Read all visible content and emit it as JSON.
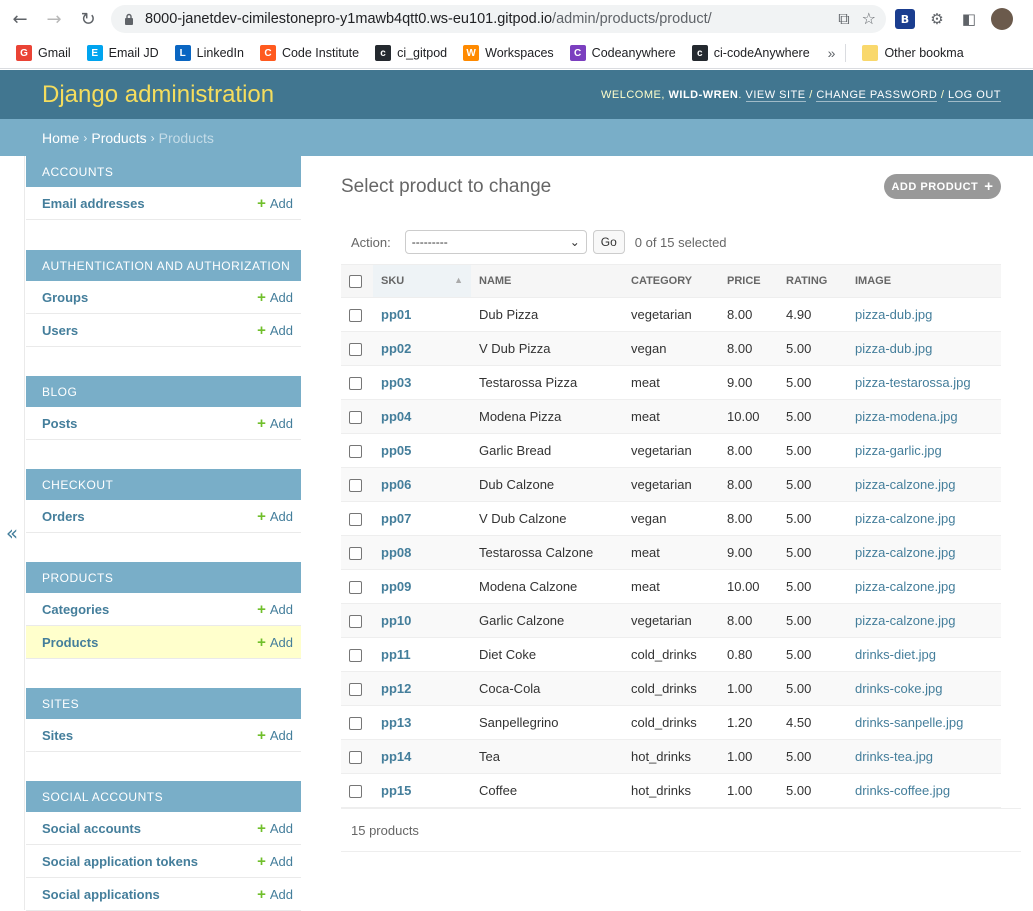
{
  "browser": {
    "url_host": "8000-janetdev-cimilestonepro-y1mawb4qtt0.ws-eu101.gitpod.io",
    "url_path": "/admin/products/product/",
    "bookmarks": [
      {
        "label": "Gmail",
        "icon": "gmail-icon",
        "color": "#ea4335"
      },
      {
        "label": "Email JD",
        "icon": "microsoft-icon",
        "color": "#00a4ef"
      },
      {
        "label": "LinkedIn",
        "icon": "linkedin-icon",
        "color": "#0a66c2"
      },
      {
        "label": "Code Institute",
        "icon": "code-institute-icon",
        "color": "#ff5a1f"
      },
      {
        "label": "ci_gitpod",
        "icon": "github-icon",
        "color": "#24292f"
      },
      {
        "label": "Workspaces",
        "icon": "gitpod-icon",
        "color": "#ff8a00"
      },
      {
        "label": "Codeanywhere",
        "icon": "codeanywhere-icon",
        "color": "#7b3fbf"
      },
      {
        "label": "ci-codeAnywhere",
        "icon": "github-icon",
        "color": "#24292f"
      }
    ],
    "bookmarks_more": "»",
    "other_bookmarks": "Other bookma"
  },
  "header": {
    "brand": "Django administration",
    "welcome": "WELCOME,",
    "user": "WILD-WREN",
    "view_site": "VIEW SITE",
    "change_password": "CHANGE PASSWORD",
    "log_out": "LOG OUT"
  },
  "breadcrumbs": {
    "home": "Home",
    "app": "Products",
    "current": "Products"
  },
  "sidebar": {
    "toggle": "«",
    "add_label": "Add",
    "modules": [
      {
        "caption": "ACCOUNTS",
        "rows": [
          "Email addresses"
        ]
      },
      {
        "caption": "AUTHENTICATION AND AUTHORIZATION",
        "rows": [
          "Groups",
          "Users"
        ]
      },
      {
        "caption": "BLOG",
        "rows": [
          "Posts"
        ]
      },
      {
        "caption": "CHECKOUT",
        "rows": [
          "Orders"
        ]
      },
      {
        "caption": "PRODUCTS",
        "rows": [
          "Categories",
          "Products"
        ]
      },
      {
        "caption": "SITES",
        "rows": [
          "Sites"
        ]
      },
      {
        "caption": "SOCIAL ACCOUNTS",
        "rows": [
          "Social accounts",
          "Social application tokens",
          "Social applications"
        ]
      }
    ],
    "current_row": "Products"
  },
  "main": {
    "title": "Select product to change",
    "add_button": "ADD PRODUCT",
    "action_label": "Action:",
    "action_selected": "---------",
    "go": "Go",
    "selected_count": "0 of 15 selected",
    "columns": [
      "SKU",
      "NAME",
      "CATEGORY",
      "PRICE",
      "RATING",
      "IMAGE"
    ],
    "rows": [
      [
        "pp01",
        "Dub Pizza",
        "vegetarian",
        "8.00",
        "4.90",
        "pizza-dub.jpg"
      ],
      [
        "pp02",
        "V Dub Pizza",
        "vegan",
        "8.00",
        "5.00",
        "pizza-dub.jpg"
      ],
      [
        "pp03",
        "Testarossa Pizza",
        "meat",
        "9.00",
        "5.00",
        "pizza-testarossa.jpg"
      ],
      [
        "pp04",
        "Modena Pizza",
        "meat",
        "10.00",
        "5.00",
        "pizza-modena.jpg"
      ],
      [
        "pp05",
        "Garlic Bread",
        "vegetarian",
        "8.00",
        "5.00",
        "pizza-garlic.jpg"
      ],
      [
        "pp06",
        "Dub Calzone",
        "vegetarian",
        "8.00",
        "5.00",
        "pizza-calzone.jpg"
      ],
      [
        "pp07",
        "V Dub Calzone",
        "vegan",
        "8.00",
        "5.00",
        "pizza-calzone.jpg"
      ],
      [
        "pp08",
        "Testarossa Calzone",
        "meat",
        "9.00",
        "5.00",
        "pizza-calzone.jpg"
      ],
      [
        "pp09",
        "Modena Calzone",
        "meat",
        "10.00",
        "5.00",
        "pizza-calzone.jpg"
      ],
      [
        "pp10",
        "Garlic Calzone",
        "vegetarian",
        "8.00",
        "5.00",
        "pizza-calzone.jpg"
      ],
      [
        "pp11",
        "Diet Coke",
        "cold_drinks",
        "0.80",
        "5.00",
        "drinks-diet.jpg"
      ],
      [
        "pp12",
        "Coca-Cola",
        "cold_drinks",
        "1.00",
        "5.00",
        "drinks-coke.jpg"
      ],
      [
        "pp13",
        "Sanpellegrino",
        "cold_drinks",
        "1.20",
        "4.50",
        "drinks-sanpelle.jpg"
      ],
      [
        "pp14",
        "Tea",
        "hot_drinks",
        "1.00",
        "5.00",
        "drinks-tea.jpg"
      ],
      [
        "pp15",
        "Coffee",
        "hot_drinks",
        "1.00",
        "5.00",
        "drinks-coffee.jpg"
      ]
    ],
    "paginator": "15 products"
  },
  "colors": {
    "header_bg": "#417690",
    "brand": "#f5dd5d",
    "module_caption_bg": "#79aec8",
    "link": "#447e9b",
    "add_plus": "#70bf2b",
    "current_row_bg": "#ffffcc"
  }
}
